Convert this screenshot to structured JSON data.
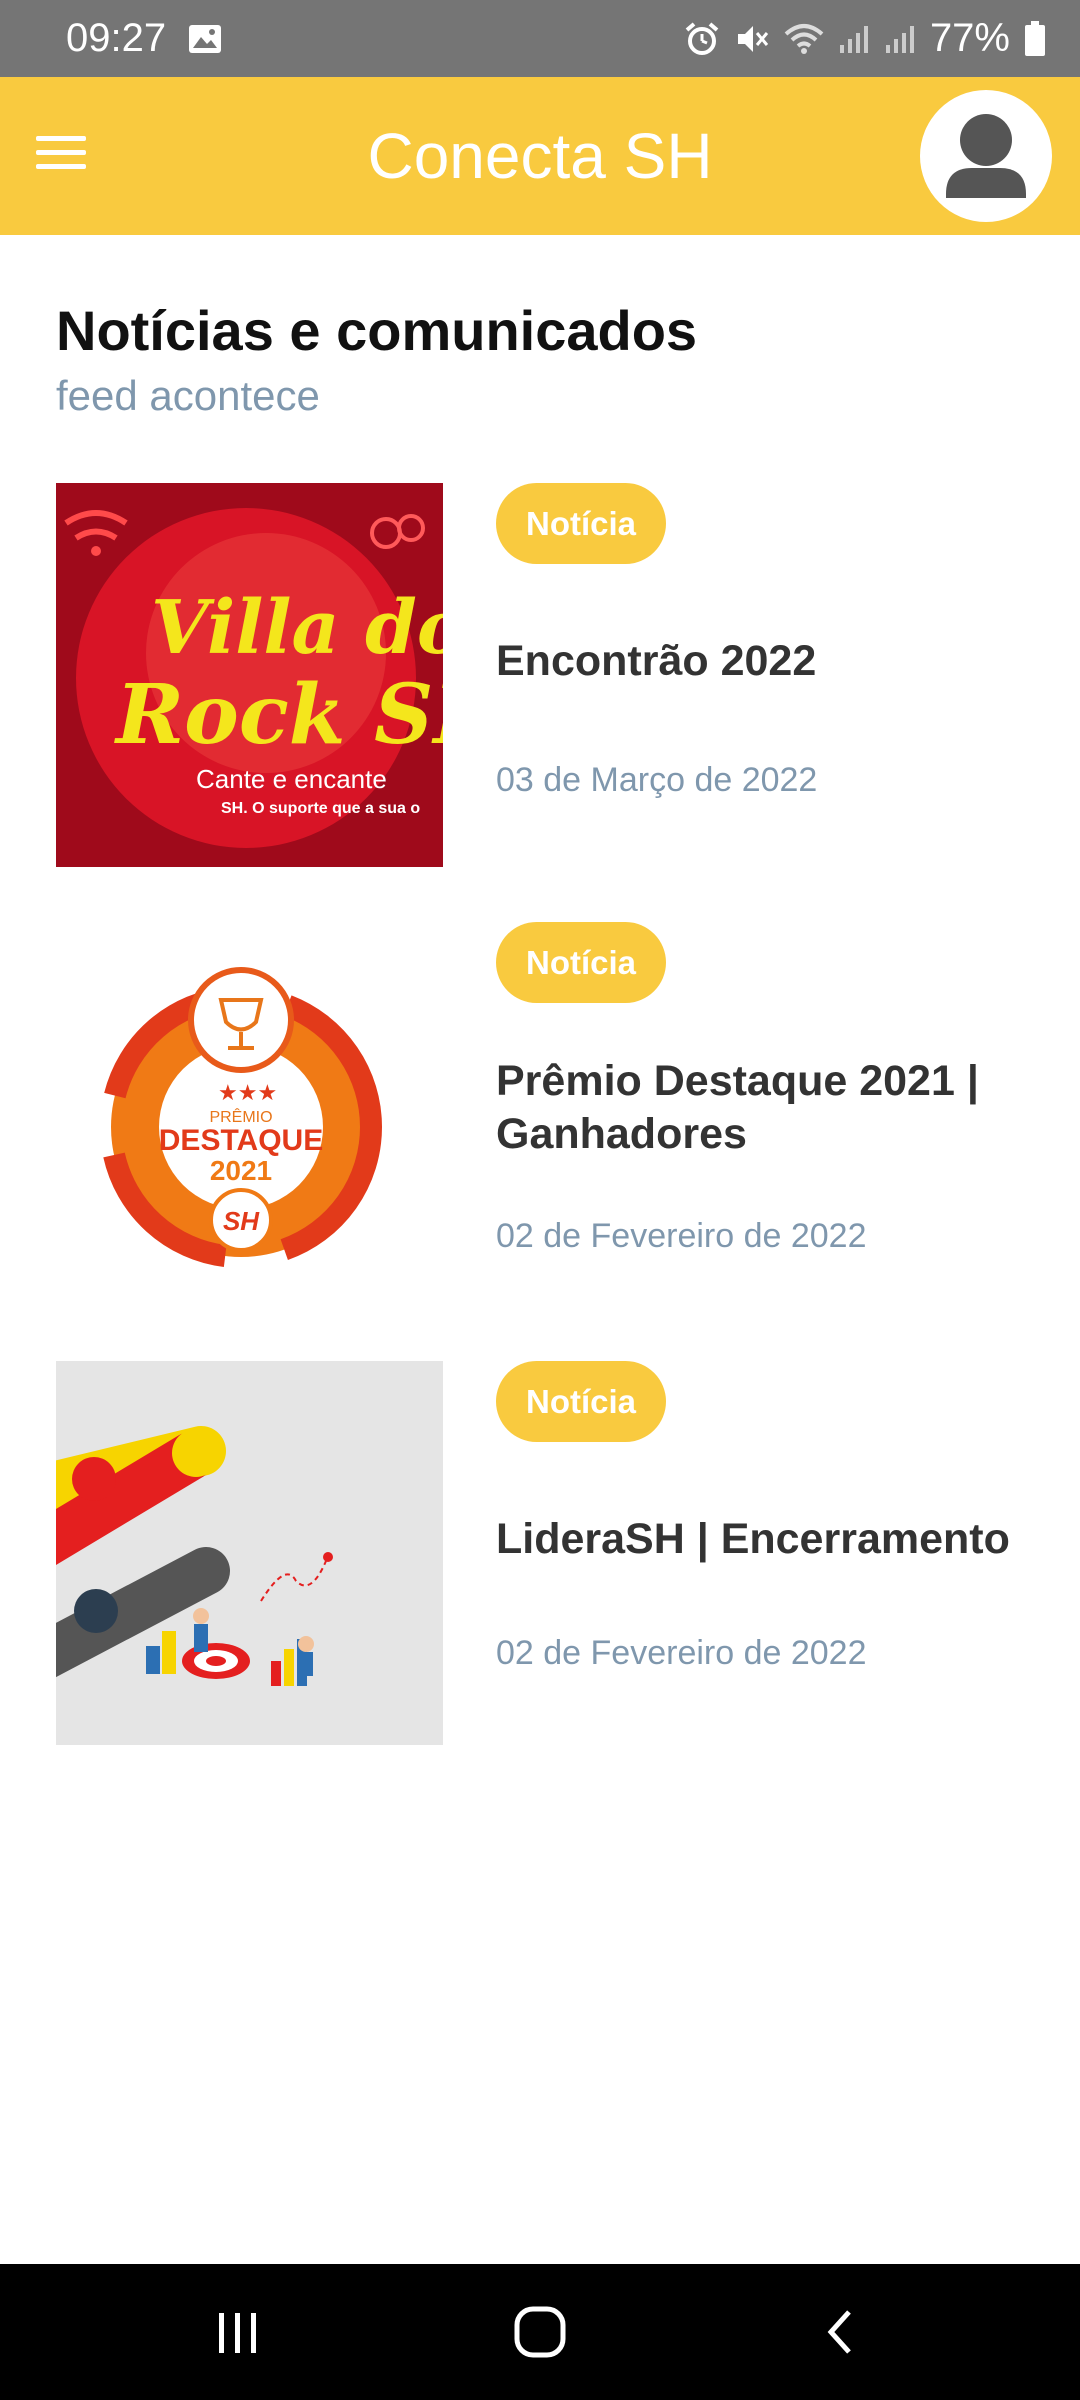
{
  "status_bar": {
    "time": "09:27",
    "battery": "77%",
    "icons": [
      "gallery-icon",
      "alarm-icon",
      "mute-icon",
      "wifi-icon",
      "signal-icon",
      "signal-icon",
      "battery-icon"
    ]
  },
  "app_bar": {
    "title": "Conecta SH",
    "menu_icon": "hamburger-menu-icon",
    "avatar_icon": "user-avatar-icon"
  },
  "page": {
    "title": "Notícias e comunicados",
    "subtitle": "feed acontece"
  },
  "news": [
    {
      "badge": "Notícia",
      "title": "Encontrão 2022",
      "date": "03 de Março de 2022",
      "thumb": {
        "line1": "Villa do",
        "line2": "Rock SH",
        "caption": "Cante e encante",
        "tagline": "SH. O suporte que a sua o"
      }
    },
    {
      "badge": "Notícia",
      "title": "Prêmio Destaque 2021 | Ganhadores",
      "date": "02 de Fevereiro de 2022",
      "thumb": {
        "label_small": "PRÊMIO",
        "label_big": "DESTAQUE",
        "year": "2021",
        "brand": "SH"
      }
    },
    {
      "badge": "Notícia",
      "title": "LideraSH | Encerramento",
      "date": "02 de Fevereiro de 2022",
      "thumb": {}
    }
  ],
  "nav_bar": {
    "icons": [
      "recent-apps-icon",
      "home-icon",
      "back-icon"
    ]
  },
  "colors": {
    "accent": "#F9CA3F",
    "status_bar": "#757575",
    "subtitle": "#7F97AD",
    "title_text": "#333333"
  }
}
